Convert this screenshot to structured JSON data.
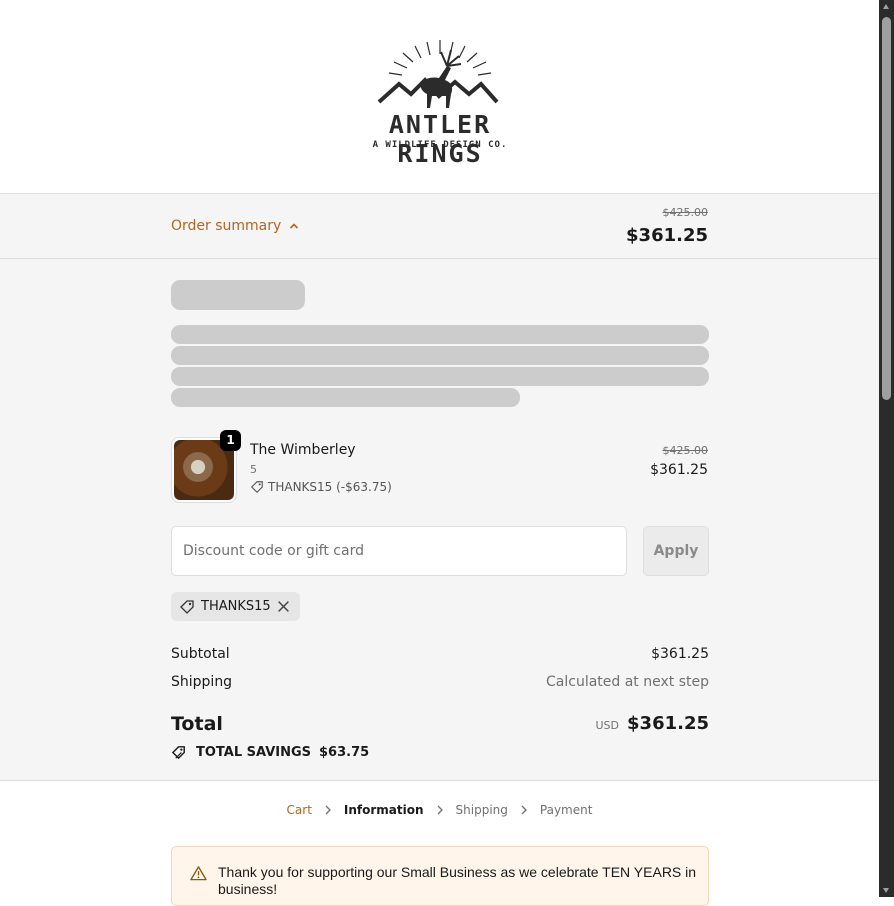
{
  "brand": {
    "name": "ANTLER RINGS",
    "tagline": "A WILDLIFE DESIGN CO."
  },
  "summary_bar": {
    "toggle_label": "Order summary",
    "original_total": "$425.00",
    "total": "$361.25"
  },
  "item": {
    "name": "The Wimberley",
    "variant": "5",
    "quantity": "1",
    "discount_label": "THANKS15 (-$63.75)",
    "original_price": "$425.00",
    "price": "$361.25"
  },
  "discount": {
    "placeholder": "Discount code or gift card",
    "apply_label": "Apply",
    "applied_code": "THANKS15"
  },
  "totals": {
    "subtotal_label": "Subtotal",
    "subtotal": "$361.25",
    "shipping_label": "Shipping",
    "shipping": "Calculated at next step",
    "total_label": "Total",
    "currency": "USD",
    "total": "$361.25",
    "savings_label": "TOTAL SAVINGS",
    "savings": "$63.75"
  },
  "breadcrumb": {
    "cart": "Cart",
    "information": "Information",
    "shipping": "Shipping",
    "payment": "Payment"
  },
  "notice": {
    "text": "Thank you for supporting our Small Business as we celebrate TEN YEARS in business!"
  },
  "colors": {
    "accent": "#b3651f",
    "skeleton": "#cccccc",
    "panel": "#f5f5f5",
    "notice_bg": "#fff5ea"
  }
}
